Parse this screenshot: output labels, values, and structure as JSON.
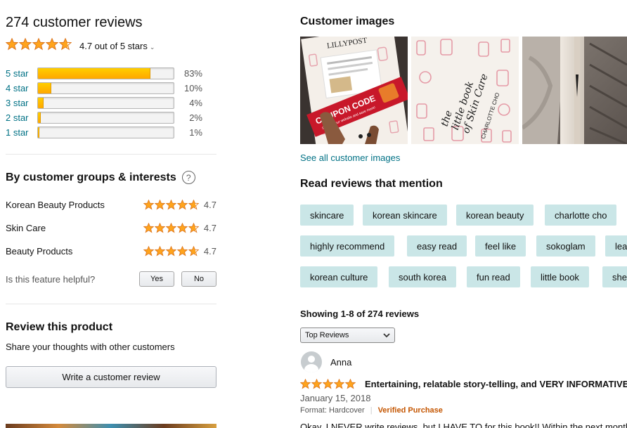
{
  "summary": {
    "title": "274 customer reviews",
    "rating_text": "4.7 out of 5 stars",
    "rating": 4.7,
    "histogram": [
      {
        "label": "5 star",
        "pct_text": "83%",
        "pct": 83
      },
      {
        "label": "4 star",
        "pct_text": "10%",
        "pct": 10
      },
      {
        "label": "3 star",
        "pct_text": "4%",
        "pct": 4
      },
      {
        "label": "2 star",
        "pct_text": "2%",
        "pct": 2
      },
      {
        "label": "1 star",
        "pct_text": "1%",
        "pct": 1
      }
    ]
  },
  "groups": {
    "title": "By customer groups & interests",
    "help_glyph": "?",
    "items": [
      {
        "name": "Korean Beauty Products",
        "score": "4.7"
      },
      {
        "name": "Skin Care",
        "score": "4.7"
      },
      {
        "name": "Beauty Products",
        "score": "4.7"
      }
    ],
    "helpful_question": "Is this feature helpful?",
    "yes_label": "Yes",
    "no_label": "No"
  },
  "review_product": {
    "title": "Review this product",
    "subtitle": "Share your thoughts with other customers",
    "button_label": "Write a customer review"
  },
  "images": {
    "title": "Customer images",
    "see_all": "See all customer images",
    "thumb1": {
      "brand": "LILLYPOST",
      "coupon": "COUPON CODE",
      "coupon_sub": "Shop on our website and save more!"
    },
    "thumb2": {
      "book_title_1": "the",
      "book_title_2": "little book",
      "book_title_3": "of Skin Care",
      "author": "CHARLOTTE CHO"
    }
  },
  "mentions": {
    "title": "Read reviews that mention",
    "chips": [
      "skincare",
      "korean skincare",
      "korean beauty",
      "charlotte cho",
      "highly recommend",
      "easy read",
      "feel like",
      "sokoglam",
      "lea",
      "korean culture",
      "south korea",
      "fun read",
      "little book",
      "she"
    ]
  },
  "reviews": {
    "showing": "Showing 1-8 of 274 reviews",
    "sort_selected": "Top Reviews",
    "first": {
      "author": "Anna",
      "stars": 5,
      "title": "Entertaining, relatable story-telling, and VERY INFORMATIVE",
      "date": "January 15, 2018",
      "format": "Format: Hardcover",
      "verified": "Verified Purchase",
      "body": "Okay, I NEVER write reviews, but I HAVE TO for this book!! Within the next month"
    }
  },
  "colors": {
    "link": "#007185",
    "star": "#ffa41c",
    "chip_bg": "#cae6e7",
    "verified": "#c45500"
  },
  "icons": {
    "star": "star-icon",
    "help": "question-circle-icon",
    "chevron": "chevron-down-icon",
    "avatar": "user-avatar-icon"
  }
}
